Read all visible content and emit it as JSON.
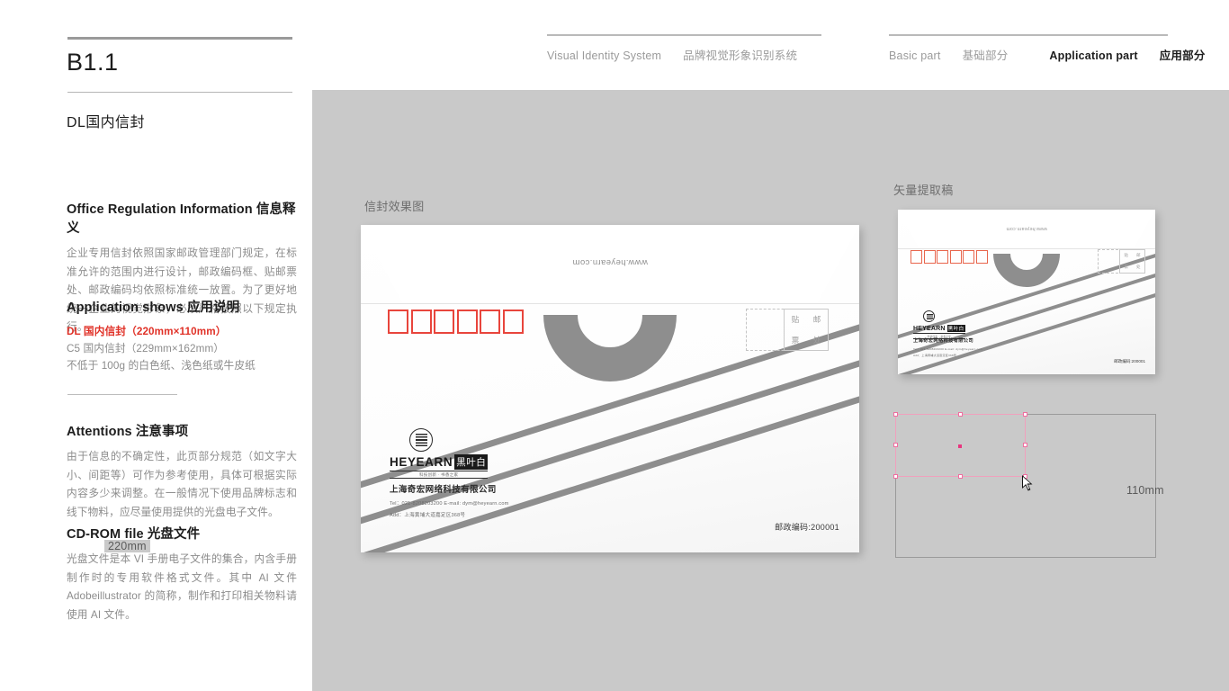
{
  "sidebar": {
    "code": "B1.1",
    "doc_title": "DL国内信封",
    "sections": [
      {
        "heading_en": "Office Regulation Information",
        "heading_cn": "信息释义",
        "body": "企业专用信封依照国家邮政管理部门规定，在标准允许的范围内进行设计，邮政编码框、贴邮票处、邮政编码均依照标准统一放置。为了更好地统一企业的视觉形象，必须严格按照以下规定执行。"
      },
      {
        "heading_en": "Application shows",
        "heading_cn": "应用说明",
        "lines": [
          "DL 国内信封（220mm×110mm）",
          "C5 国内信封（229mm×162mm）",
          "不低于 100g 的白色纸、浅色纸或牛皮纸"
        ],
        "highlight_color": "#e03127"
      },
      {
        "heading_en": "Attentions",
        "heading_cn": "注意事项",
        "body": "由于信息的不确定性，此页部分规范（如文字大小、间距等）可作为参考使用，具体可根据实际内容多少来调整。在一般情况下使用品牌标志和线下物料，应尽量使用提供的光盘电子文件。"
      },
      {
        "heading_en": "CD-ROM file",
        "heading_cn": "光盘文件",
        "body": "光盘文件是本 VI 手册电子文件的集合，内含手册制作时的专用软件格式文件。其中 AI 文件 Adobeillustrator 的简称，制作和打印相关物料请使用 AI 文件。"
      }
    ]
  },
  "nav": {
    "group1": {
      "en": "Visual Identity System",
      "cn": "品牌视觉形象识别系统"
    },
    "group2": [
      {
        "en": "Basic part",
        "cn": "基础部分",
        "active": false
      },
      {
        "en": "Application part",
        "cn": "应用部分",
        "active": true
      }
    ]
  },
  "canvas": {
    "label_mockup": "信封效果图",
    "label_vector": "矢量提取稿",
    "bg_color": "#c9c9c9"
  },
  "envelope": {
    "website": "www.heyearn.com",
    "stamp_chars": [
      "贴",
      "邮",
      "票",
      "处"
    ],
    "postal_box_count": 6,
    "postal_box_color": "#e8453c",
    "logo": {
      "en": "HEYEARN",
      "cn": "黑叶白",
      "sub": "科技创新 · 书香之家"
    },
    "company": "上海奇宏网络科技有限公司",
    "tel_email": "Tel：021-8208203200    E-mail: dym@heyearn.com",
    "address": "Add：上海黄埔大道嘉定区368号",
    "postcode": "邮政编码:200001",
    "stripe_color": "#8e8e8e",
    "ring_color": "#8e8e8e"
  },
  "dimensions": {
    "width_label": "220mm",
    "height_label": "110mm",
    "selection_color": "#ee6fa0",
    "frame_color": "#9a9a9a"
  }
}
